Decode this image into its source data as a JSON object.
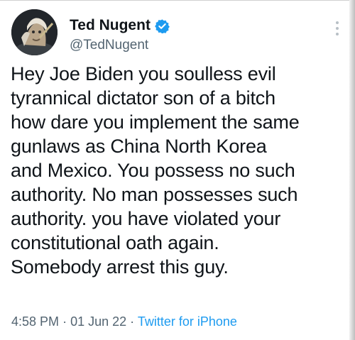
{
  "tweet": {
    "author": {
      "display_name": "Ted Nugent",
      "handle": "@TedNugent",
      "verified": true,
      "verified_color": "#1d9bf0",
      "avatar_icon": "profile-photo"
    },
    "text": "Hey Joe Biden you soulless evil\ntyrannical dictator son of a bitch\nhow dare you implement the same\ngunlaws as China North Korea\nand Mexico. You possess no such\nauthority. No man possesses such\nauthority. you have violated your\nconstitutional oath again.\nSomebody arrest this guy.",
    "time": "4:58 PM",
    "separator": "·",
    "date": "01 Jun 22",
    "source": "Twitter for iPhone",
    "menu_icon": "more-vertical-icon"
  },
  "colors": {
    "text": "#0f1419",
    "secondary": "#536471",
    "link": "#1d9bf0"
  }
}
